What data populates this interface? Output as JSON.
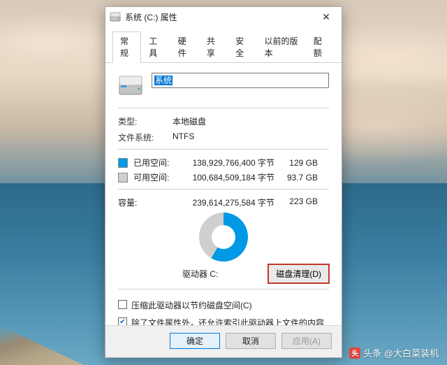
{
  "window": {
    "title": "系统 (C:) 属性"
  },
  "tabs": {
    "general": "常规",
    "tools": "工具",
    "hardware": "硬件",
    "sharing": "共享",
    "security": "安全",
    "previous": "以前的版本",
    "quota": "配额"
  },
  "name_field": {
    "value": "系统"
  },
  "type": {
    "label": "类型:",
    "value": "本地磁盘"
  },
  "fs": {
    "label": "文件系统:",
    "value": "NTFS"
  },
  "used": {
    "label": "已用空间:",
    "bytes": "138,929,766,400 字节",
    "gb": "129 GB",
    "color": "#0099e5"
  },
  "free": {
    "label": "可用空间:",
    "bytes": "100,684,509,184 字节",
    "gb": "93.7 GB",
    "color": "#cfcfcf"
  },
  "capacity": {
    "label": "容量:",
    "bytes": "239,614,275,584 字节",
    "gb": "223 GB"
  },
  "drive_label": "驱动器 C:",
  "cleanup_btn": "磁盘清理(D)",
  "compress_check": "压缩此驱动器以节约磁盘空间(C)",
  "index_check": "除了文件属性外，还允许索引此驱动器上文件的内容(I)",
  "buttons": {
    "ok": "确定",
    "cancel": "取消",
    "apply": "应用(A)"
  },
  "watermark": "头条 @大白菜装机",
  "chart_data": {
    "type": "pie",
    "title": "驱动器 C:",
    "series": [
      {
        "name": "已用空间",
        "value": 138929766400,
        "display": "129 GB",
        "color": "#0099e5"
      },
      {
        "name": "可用空间",
        "value": 100684509184,
        "display": "93.7 GB",
        "color": "#cfcfcf"
      }
    ],
    "total": {
      "value": 239614275584,
      "display": "223 GB"
    }
  }
}
